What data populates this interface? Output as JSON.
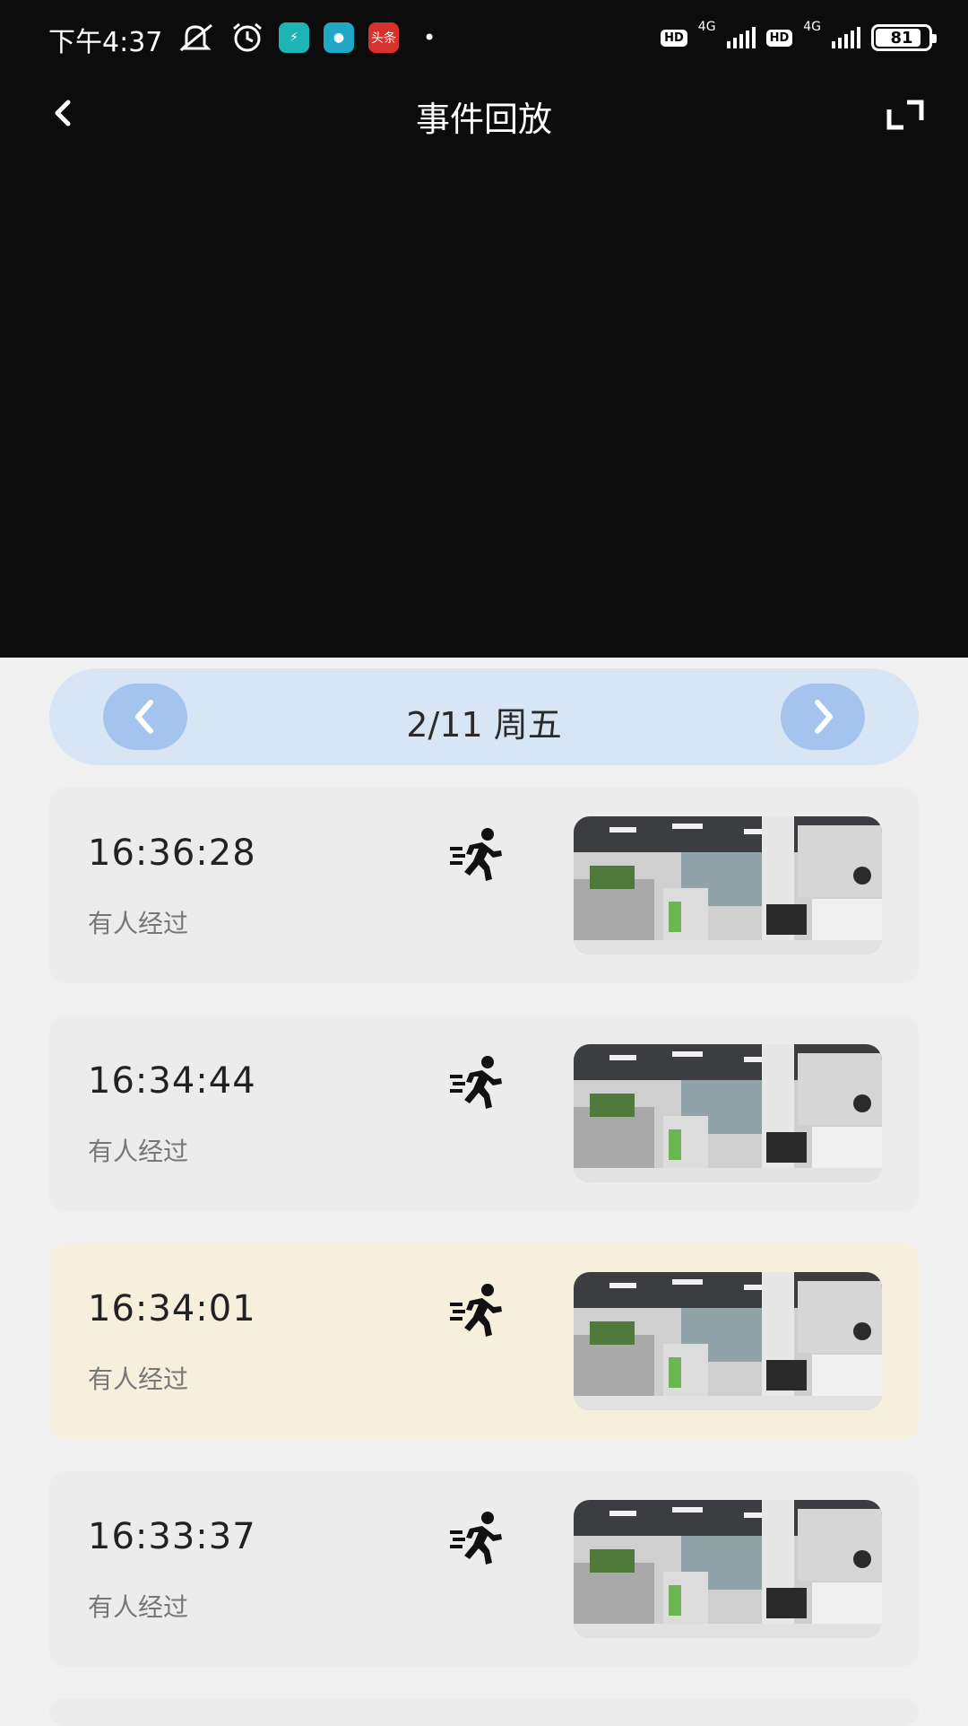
{
  "status_bar": {
    "time": "下午4:37",
    "app_badge": "头条",
    "network_1": "4G",
    "network_2": "4G",
    "hd_label": "HD",
    "battery": "81"
  },
  "header": {
    "title": "事件回放",
    "back_icon": "chevron-left-icon",
    "fullscreen_icon": "fullscreen-icon"
  },
  "date_nav": {
    "label": "2/11 周五",
    "prev_icon": "chevron-left-icon",
    "next_icon": "chevron-right-icon"
  },
  "events": [
    {
      "time": "16:36:28",
      "desc": "有人经过",
      "selected": false,
      "icon": "running-person-icon"
    },
    {
      "time": "16:34:44",
      "desc": "有人经过",
      "selected": false,
      "icon": "running-person-icon"
    },
    {
      "time": "16:34:01",
      "desc": "有人经过",
      "selected": true,
      "icon": "running-person-icon"
    },
    {
      "time": "16:33:37",
      "desc": "有人经过",
      "selected": false,
      "icon": "running-person-icon"
    }
  ],
  "colors": {
    "video_bg": "#0c0c0c",
    "date_bar": "#d8e5f4",
    "nav_button": "#a4c3ef",
    "selected_card": "#f5efdb",
    "card": "#ececec"
  }
}
